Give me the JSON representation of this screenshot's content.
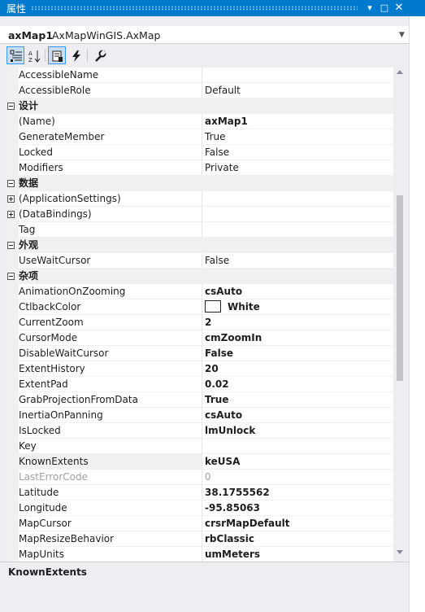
{
  "window": {
    "title": "属性"
  },
  "object_selector": {
    "name": "axMap1",
    "type": "AxMapWinGIS.AxMap"
  },
  "properties": [
    {
      "kind": "prop",
      "name": "AccessibleName",
      "value": "",
      "bold": false
    },
    {
      "kind": "prop",
      "name": "AccessibleRole",
      "value": "Default",
      "bold": false
    },
    {
      "kind": "cat",
      "name": "设计"
    },
    {
      "kind": "prop",
      "name": "(Name)",
      "value": "axMap1",
      "bold": true
    },
    {
      "kind": "prop",
      "name": "GenerateMember",
      "value": "True",
      "bold": false
    },
    {
      "kind": "prop",
      "name": "Locked",
      "value": "False",
      "bold": false
    },
    {
      "kind": "prop",
      "name": "Modifiers",
      "value": "Private",
      "bold": false
    },
    {
      "kind": "cat",
      "name": "数据"
    },
    {
      "kind": "prop",
      "name": "(ApplicationSettings)",
      "value": "",
      "bold": false,
      "expand": "plus"
    },
    {
      "kind": "prop",
      "name": "(DataBindings)",
      "value": "",
      "bold": false,
      "expand": "plus"
    },
    {
      "kind": "prop",
      "name": "Tag",
      "value": "",
      "bold": false
    },
    {
      "kind": "cat",
      "name": "外观"
    },
    {
      "kind": "prop",
      "name": "UseWaitCursor",
      "value": "False",
      "bold": false
    },
    {
      "kind": "cat",
      "name": "杂项"
    },
    {
      "kind": "prop",
      "name": "AnimationOnZooming",
      "value": "csAuto",
      "bold": true
    },
    {
      "kind": "prop",
      "name": "CtlbackColor",
      "value": "White",
      "bold": true,
      "swatch": "#ffffff"
    },
    {
      "kind": "prop",
      "name": "CurrentZoom",
      "value": "2",
      "bold": true
    },
    {
      "kind": "prop",
      "name": "CursorMode",
      "value": "cmZoomIn",
      "bold": true
    },
    {
      "kind": "prop",
      "name": "DisableWaitCursor",
      "value": "False",
      "bold": true
    },
    {
      "kind": "prop",
      "name": "ExtentHistory",
      "value": "20",
      "bold": true
    },
    {
      "kind": "prop",
      "name": "ExtentPad",
      "value": "0.02",
      "bold": true
    },
    {
      "kind": "prop",
      "name": "GrabProjectionFromData",
      "value": "True",
      "bold": true
    },
    {
      "kind": "prop",
      "name": "InertiaOnPanning",
      "value": "csAuto",
      "bold": true
    },
    {
      "kind": "prop",
      "name": "IsLocked",
      "value": "lmUnlock",
      "bold": true
    },
    {
      "kind": "prop",
      "name": "Key",
      "value": "",
      "bold": false
    },
    {
      "kind": "prop",
      "name": "KnownExtents",
      "value": "keUSA",
      "bold": true,
      "selected": true
    },
    {
      "kind": "prop",
      "name": "LastErrorCode",
      "value": "0",
      "bold": false,
      "disabled": true
    },
    {
      "kind": "prop",
      "name": "Latitude",
      "value": "38.1755562",
      "bold": true
    },
    {
      "kind": "prop",
      "name": "Longitude",
      "value": "-95.85063",
      "bold": true
    },
    {
      "kind": "prop",
      "name": "MapCursor",
      "value": "crsrMapDefault",
      "bold": true
    },
    {
      "kind": "prop",
      "name": "MapResizeBehavior",
      "value": "rbClassic",
      "bold": true
    },
    {
      "kind": "prop",
      "name": "MapUnits",
      "value": "umMeters",
      "bold": true
    }
  ],
  "description": {
    "title": "KnownExtents"
  },
  "toolbar": {
    "buttons": [
      {
        "name": "categorized-icon",
        "active": true
      },
      {
        "name": "alphabetical-icon",
        "active": false
      },
      {
        "name": "properties-icon",
        "active": true
      },
      {
        "name": "events-icon",
        "active": false
      },
      {
        "name": "property-pages-icon",
        "active": false
      }
    ]
  }
}
